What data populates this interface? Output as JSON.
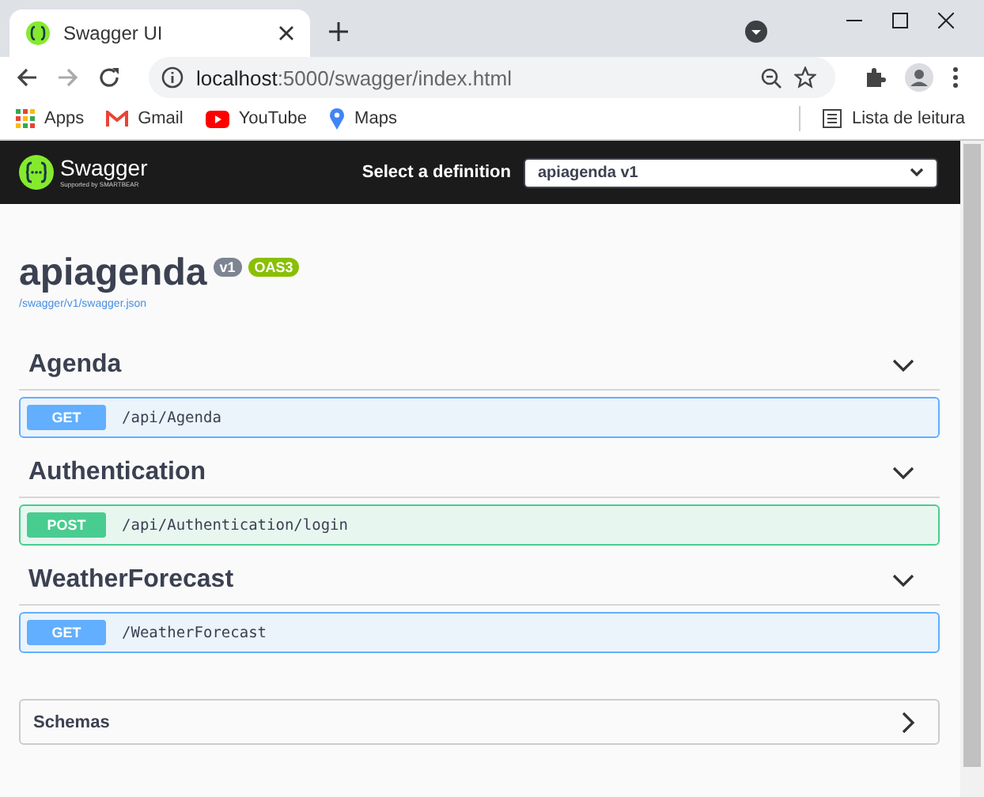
{
  "browser": {
    "tab_title": "Swagger UI",
    "url_host": "localhost",
    "url_rest": ":5000/swagger/index.html",
    "bookmarks": [
      "Apps",
      "Gmail",
      "YouTube",
      "Maps"
    ],
    "reading_list": "Lista de leitura"
  },
  "header": {
    "logo_text": "Swagger",
    "logo_sub": "Supported by SMARTBEAR",
    "definition_label": "Select a definition",
    "definition_value": "apiagenda v1"
  },
  "info": {
    "title": "apiagenda",
    "version": "v1",
    "oas": "OAS3",
    "link": "/swagger/v1/swagger.json"
  },
  "sections": [
    {
      "name": "Agenda",
      "expanded": true,
      "operations": [
        {
          "kind": "get",
          "method": "GET",
          "path": "/api/Agenda"
        }
      ]
    },
    {
      "name": "Authentication",
      "expanded": true,
      "operations": [
        {
          "kind": "post",
          "method": "POST",
          "path": "/api/Authentication/login"
        }
      ]
    },
    {
      "name": "WeatherForecast",
      "expanded": true,
      "operations": [
        {
          "kind": "get",
          "method": "GET",
          "path": "/WeatherForecast"
        }
      ]
    }
  ],
  "schemas": {
    "title": "Schemas",
    "expanded": false
  }
}
